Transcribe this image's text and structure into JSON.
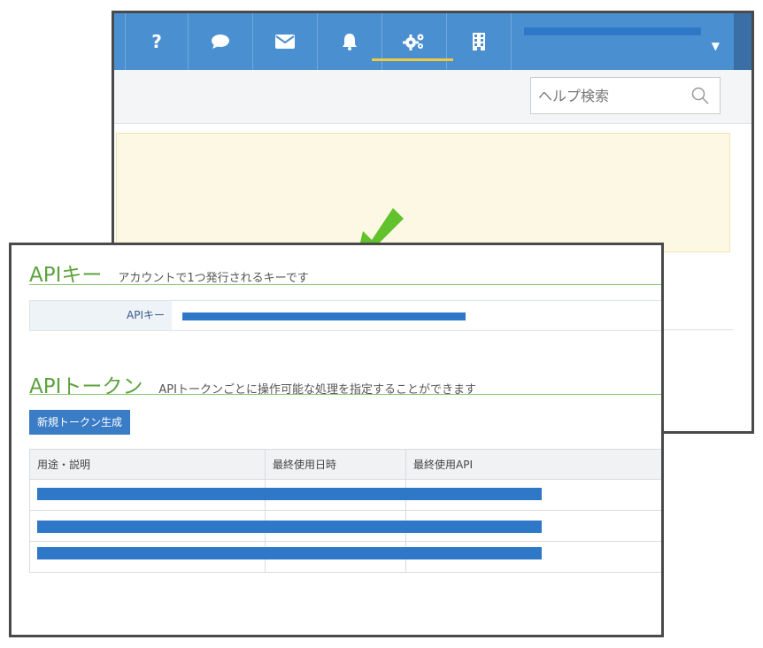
{
  "help": {
    "search_placeholder": "ヘルプ検索"
  },
  "api_key_section": {
    "title": "APIキー",
    "description": "アカウントで1つ発行されるキーです",
    "key_label": "APIキー"
  },
  "api_token_section": {
    "title": "APIトークン",
    "description": "APIトークンごとに操作可能な処理を指定することができます",
    "new_token_button": "新規トークン生成",
    "columns": [
      "用途・説明",
      "最終使用日時",
      "最終使用API"
    ]
  },
  "colors": {
    "nav_blue": "#4a8fd0",
    "accent_green": "#5da33e",
    "active_underline": "#f0c93c",
    "redaction_blue": "#2f78c8",
    "notice_yellow": "#fcf8e3"
  },
  "icons": {
    "nav": [
      "help-icon",
      "chat-icon",
      "mail-icon",
      "bell-icon",
      "gears-icon",
      "building-icon"
    ],
    "search": "search-icon",
    "account": "chevron-down-icon",
    "arrow": "arrow-down-left-icon"
  }
}
